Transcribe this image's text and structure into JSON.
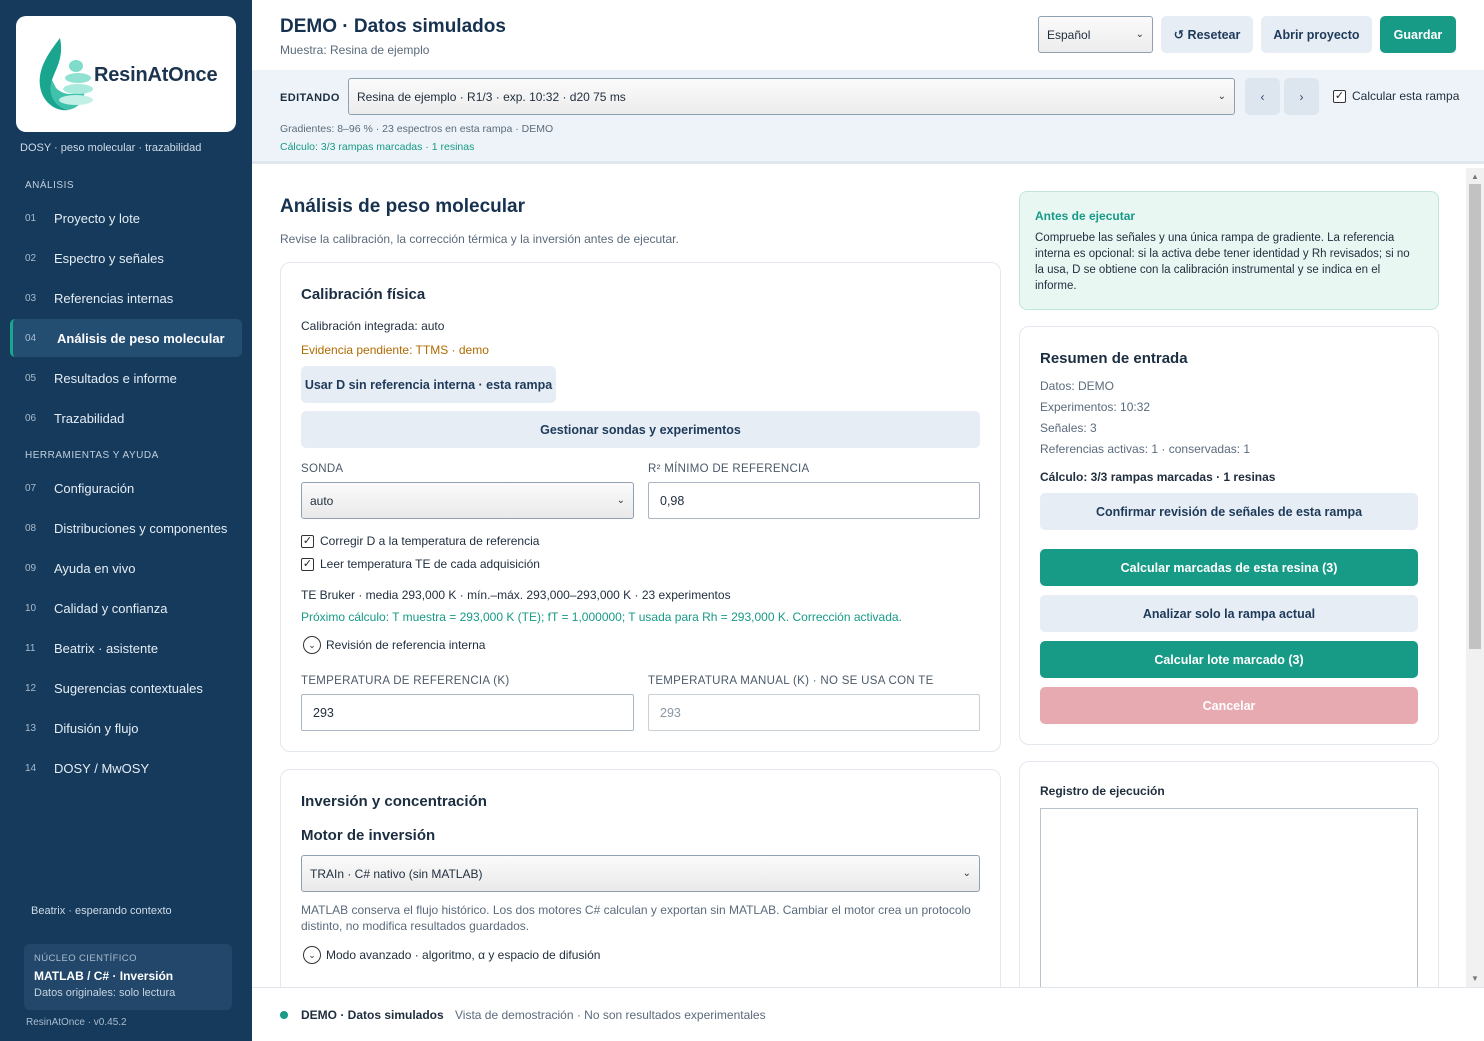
{
  "sidebar": {
    "logo_text": "ResinAtOnce",
    "tagline": "DOSY · peso molecular · trazabilidad",
    "section_analysis": "ANÁLISIS",
    "section_tools": "HERRAMIENTAS Y AYUDA",
    "items": [
      {
        "num": "01",
        "label": "Proyecto y lote"
      },
      {
        "num": "02",
        "label": "Espectro y señales"
      },
      {
        "num": "03",
        "label": "Referencias internas"
      },
      {
        "num": "04",
        "label": "Análisis de peso molecular"
      },
      {
        "num": "05",
        "label": "Resultados e informe"
      },
      {
        "num": "06",
        "label": "Trazabilidad"
      },
      {
        "num": "07",
        "label": "Configuración"
      },
      {
        "num": "08",
        "label": "Distribuciones y componentes"
      },
      {
        "num": "09",
        "label": "Ayuda en vivo"
      },
      {
        "num": "10",
        "label": "Calidad y confianza"
      },
      {
        "num": "11",
        "label": "Beatrix · asistente"
      },
      {
        "num": "12",
        "label": "Sugerencias contextuales"
      },
      {
        "num": "13",
        "label": "Difusión y flujo"
      },
      {
        "num": "14",
        "label": "DOSY / MwOSY"
      }
    ],
    "beatrix_status": "Beatrix · esperando contexto",
    "core": {
      "label": "NÚCLEO CIENTÍFICO",
      "title": "MATLAB / C# · Inversión",
      "subtitle": "Datos originales: solo lectura"
    },
    "version": "ResinAtOnce · v0.45.2"
  },
  "header": {
    "title": "DEMO · Datos simulados",
    "subtitle": "Muestra: Resina de ejemplo",
    "language": "Español",
    "reset_label": "↺ Resetear",
    "open_label": "Abrir proyecto",
    "save_label": "Guardar"
  },
  "editbar": {
    "label": "EDITANDO",
    "selected": "Resina de ejemplo · R1/3 · exp. 10:32 · d20 75 ms",
    "prev": "‹",
    "next": "›",
    "calc_label": "Calcular esta rampa",
    "info1": "Gradientes: 8–96 % · 23 espectros en esta rampa · DEMO",
    "info2": "Cálculo: 3/3 rampas marcadas · 1 resinas"
  },
  "main": {
    "title": "Análisis de peso molecular",
    "subtitle": "Revise la calibración, la corrección térmica y la inversión antes de ejecutar.",
    "calibration": {
      "title": "Calibración física",
      "integrated": "Calibración integrada: auto",
      "pending": "Evidencia pendiente: TTMS · demo",
      "use_d_button": "Usar D sin referencia interna · esta rampa",
      "manage_button": "Gestionar sondas y experimentos",
      "probe_label": "SONDA",
      "probe_value": "auto",
      "r2_label": "R² MÍNIMO DE REFERENCIA",
      "r2_value": "0,98",
      "correct_d": "Corregir D a la temperatura de referencia",
      "read_te": "Leer temperatura TE de cada adquisición",
      "te_info": "TE Bruker · media 293,000 K · mín.–máx. 293,000–293,000 K · 23 experimentos",
      "next_calc": "Próximo cálculo: T muestra = 293,000 K (TE); fT = 1,000000; T usada para Rh = 293,000 K. Corrección activada.",
      "review_label": "Revisión de referencia interna",
      "ref_temp_label": "TEMPERATURA DE REFERENCIA (K)",
      "ref_temp_value": "293",
      "manual_temp_label": "TEMPERATURA MANUAL (K) · NO SE USA CON TE",
      "manual_temp_value": "293"
    },
    "inversion": {
      "title": "Inversión y concentración",
      "engine_title": "Motor de inversión",
      "engine_value": "TRAIn · C# nativo (sin MATLAB)",
      "note1": "MATLAB conserva el flujo histórico. Los dos motores C# calculan y exportan sin MATLAB. Cambiar el motor crea un protocolo",
      "note2": "distinto, no modifica resultados guardados.",
      "advanced_label": "Modo avanzado · algoritmo, α y espacio de difusión"
    }
  },
  "right": {
    "alert_title": "Antes de ejecutar",
    "alert_lines": [
      "Compruebe las señales y una única rampa de gradiente. La referencia",
      "interna es opcional: si la activa debe tener identidad y Rh revisados; si no",
      "la usa, D se obtiene con la calibración instrumental y se indica en el",
      "informe."
    ],
    "summary": {
      "title": "Resumen de entrada",
      "data": "Datos: DEMO",
      "experiments": "Experimentos: 10:32",
      "signals": "Señales: 3",
      "references": "Referencias activas: 1 · conservadas: 1",
      "calc": "Cálculo: 3/3 rampas marcadas · 1 resinas",
      "confirm_button": "Confirmar revisión de señales de esta rampa",
      "calc_marked_button": "Calcular marcadas de esta resina (3)",
      "analyze_button": "Analizar solo la rampa actual",
      "batch_button": "Calcular lote marcado (3)",
      "cancel_button": "Cancelar"
    },
    "log_title": "Registro de ejecución"
  },
  "footer": {
    "title": "DEMO · Datos simulados",
    "note": "Vista de demostración · No son resultados experimentales"
  },
  "colors": {
    "sidebar": "#163a5c",
    "accent": "#179a86",
    "warning": "#b06a00",
    "cancel": "#e8aab1"
  }
}
